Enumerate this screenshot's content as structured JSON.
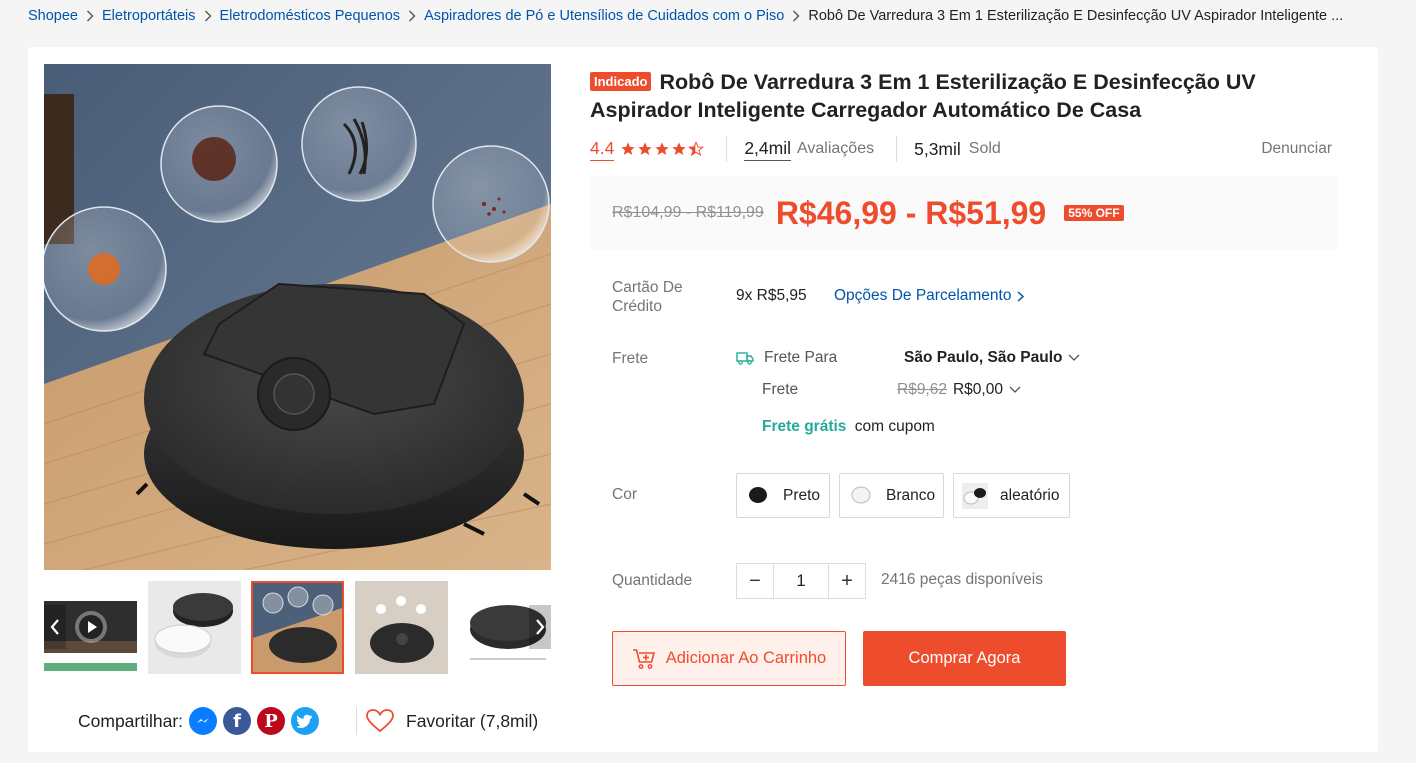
{
  "breadcrumb": {
    "items": [
      "Shopee",
      "Eletroportáteis",
      "Eletrodomésticos Pequenos",
      "Aspiradores de Pó e Utensílios de Cuidados com o Piso"
    ],
    "current": "Robô De Varredura 3 Em 1 Esterilização E Desinfecção UV Aspirador Inteligente ..."
  },
  "product": {
    "tag": "Indicado",
    "title": "Robô De Varredura 3 Em 1 Esterilização E Desinfecção UV Aspirador Inteligente Carregador Automático De Casa",
    "rating_value": "4.4",
    "rating_stars": 4.4,
    "reviews_count": "2,4mil",
    "reviews_label": "Avaliações",
    "sold_count": "5,3mil",
    "sold_label": "Sold",
    "report_label": "Denunciar"
  },
  "price": {
    "original": "R$104,99 - R$119,99",
    "current": "R$46,99 - R$51,99",
    "discount": "55% OFF"
  },
  "installment": {
    "label": "Cartão De Crédito",
    "value": "9x R$5,95",
    "link": "Opções De Parcelamento"
  },
  "shipping": {
    "label": "Frete",
    "to_label": "Frete Para",
    "destination": "São Paulo, São Paulo",
    "cost_label": "Frete",
    "cost_original": "R$9,62",
    "cost_current": "R$0,00",
    "free_label": "Frete grátis",
    "free_suffix": "com cupom"
  },
  "color": {
    "label": "Cor",
    "options": [
      "Preto",
      "Branco",
      "aleatório"
    ]
  },
  "quantity": {
    "label": "Quantidade",
    "value": "1",
    "minus": "−",
    "plus": "+",
    "stock": "2416 peças disponíveis"
  },
  "actions": {
    "add_to_cart": "Adicionar Ao Carrinho",
    "buy_now": "Comprar Agora"
  },
  "share": {
    "label": "Compartilhar:",
    "icons": [
      "messenger-icon",
      "facebook-icon",
      "pinterest-icon",
      "twitter-icon"
    ]
  },
  "favorite": {
    "label": "Favoritar (7,8mil)"
  },
  "colors": {
    "accent": "#ee4d2d",
    "link": "#0055aa",
    "teal": "#26aa99"
  }
}
